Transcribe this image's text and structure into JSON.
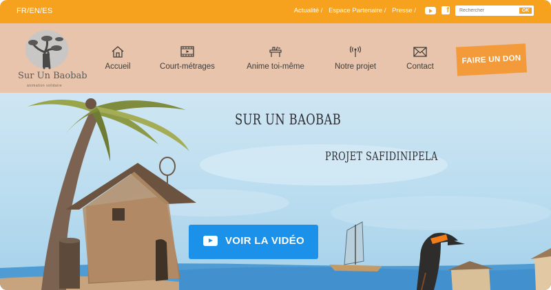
{
  "topbar": {
    "languages": [
      "FR",
      "EN",
      "ES"
    ],
    "lang_sep": " / ",
    "links": [
      "Actualité /",
      "Espace Partenaire /",
      "Presse /"
    ],
    "search_placeholder": "Rechercher",
    "search_button": "OK",
    "social_icons": [
      "youtube-icon",
      "facebook-icon"
    ]
  },
  "logo": {
    "name": "Sur Un Baobab",
    "tagline": "animation solidaire"
  },
  "nav": {
    "items": [
      {
        "label": "Accueil",
        "icon": "home-icon"
      },
      {
        "label": "Court-métrages",
        "icon": "film-icon"
      },
      {
        "label": "Anime toi-même",
        "icon": "workshop-icon"
      },
      {
        "label": "Notre projet",
        "icon": "antenna-icon"
      },
      {
        "label": "Contact",
        "icon": "envelope-icon"
      }
    ],
    "donate_label": "FAIRE UN DON"
  },
  "hero": {
    "title": "SUR UN BAOBAB",
    "subtitle": "PROJET SAFIDINIPELA",
    "video_button": "VOIR LA VIDÉO"
  },
  "colors": {
    "topbar": "#f6a21e",
    "nav_bg": "#e7c4ab",
    "donate": "#f39a3a",
    "video_button": "#1c91e9"
  }
}
